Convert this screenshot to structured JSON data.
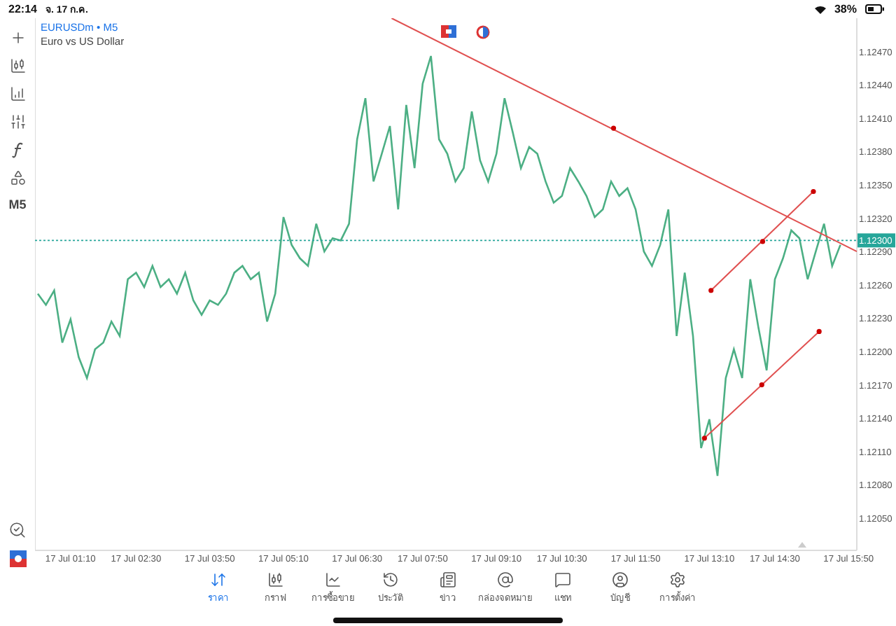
{
  "status_bar": {
    "time": "22:14",
    "date": "จ. 17 ก.ค.",
    "battery": "38%"
  },
  "header": {
    "symbol": "EURUSDm",
    "separator": "•",
    "timeframe": "M5",
    "description": "Euro vs US Dollar"
  },
  "toolbar": {
    "timeframe": "M5"
  },
  "chart": {
    "chart_data": {
      "type": "line",
      "ylim": [
        1.12021,
        1.125
      ],
      "categories": [
        null,
        null,
        null,
        null,
        "17 Jul 01:10",
        null,
        null,
        null,
        null,
        null,
        null,
        null,
        "17 Jul 02:30",
        null,
        null,
        null,
        null,
        null,
        null,
        null,
        null,
        "17 Jul 03:50",
        null,
        null,
        null,
        null,
        null,
        null,
        null,
        null,
        "17 Jul 05:10",
        null,
        null,
        null,
        null,
        null,
        null,
        null,
        null,
        "17 Jul 06:30",
        null,
        null,
        null,
        null,
        null,
        null,
        null,
        "17 Jul 07:50",
        null,
        null,
        null,
        null,
        null,
        null,
        null,
        null,
        "17 Jul 09:10",
        null,
        null,
        null,
        null,
        null,
        null,
        null,
        "17 Jul 10:30",
        null,
        null,
        null,
        null,
        null,
        null,
        null,
        null,
        "17 Jul 11:50",
        null,
        null,
        null,
        null,
        null,
        null,
        null,
        null,
        "17 Jul 13:10",
        null,
        null,
        null,
        null,
        null,
        null,
        null,
        "17 Jul 14:30",
        null,
        null,
        null,
        null,
        null,
        null,
        null,
        null,
        "17 Jul 15:50"
      ],
      "series": [
        {
          "color": "#4caf84",
          "values": [
            1.12252,
            1.12242,
            1.12255,
            1.12208,
            1.12229,
            1.12195,
            1.12176,
            1.12202,
            1.12208,
            1.12227,
            1.12214,
            1.12265,
            1.12271,
            1.12258,
            1.12277,
            1.12258,
            1.12265,
            1.12252,
            1.12271,
            1.12246,
            1.12233,
            1.12246,
            1.12242,
            1.12252,
            1.12271,
            1.12277,
            1.12265,
            1.12271,
            1.12227,
            1.12252,
            1.12321,
            1.12296,
            1.12284,
            1.12277,
            1.12315,
            1.1229,
            1.12302,
            1.123,
            1.12315,
            1.12391,
            1.12428,
            1.12353,
            1.12378,
            1.12403,
            1.12328,
            1.12422,
            1.12365,
            1.12441,
            1.12466,
            1.12391,
            1.12378,
            1.12353,
            1.12365,
            1.12416,
            1.12372,
            1.12353,
            1.12378,
            1.12428,
            1.12397,
            1.12365,
            1.12384,
            1.12378,
            1.12353,
            1.12334,
            1.1234,
            1.12365,
            1.12353,
            1.1234,
            1.12321,
            1.12328,
            1.12353,
            1.1234,
            1.12347,
            1.12328,
            1.1229,
            1.12277,
            1.12296,
            1.12328,
            1.12214,
            1.12271,
            1.12214,
            1.12113,
            1.12139,
            1.12088,
            1.12176,
            1.12202,
            1.12176,
            1.12265,
            1.12221,
            1.12183,
            1.12265,
            1.12284,
            1.12309,
            1.12302,
            1.12265,
            1.1229,
            1.12315,
            1.12277,
            1.12296,
            null
          ]
        }
      ],
      "yticks": [
        {
          "value": 1.1247,
          "label": "1.12470"
        },
        {
          "value": 1.1244,
          "label": "1.12440"
        },
        {
          "value": 1.1241,
          "label": "1.12410"
        },
        {
          "value": 1.1238,
          "label": "1.12380"
        },
        {
          "value": 1.1235,
          "label": "1.12350"
        },
        {
          "value": 1.1232,
          "label": "1.12320"
        },
        {
          "value": 1.1229,
          "label": "1.12290"
        },
        {
          "value": 1.1226,
          "label": "1.12260"
        },
        {
          "value": 1.1223,
          "label": "1.12230"
        },
        {
          "value": 1.122,
          "label": "1.12200"
        },
        {
          "value": 1.1217,
          "label": "1.12170"
        },
        {
          "value": 1.1214,
          "label": "1.12140"
        },
        {
          "value": 1.1211,
          "label": "1.12110"
        },
        {
          "value": 1.1208,
          "label": "1.12080"
        },
        {
          "value": 1.1205,
          "label": "1.12050"
        }
      ],
      "ref_lines": [
        {
          "axis": "y",
          "value": 1.123,
          "label": "1.12300"
        }
      ]
    },
    "drawings": [
      {
        "kind": "trend_line"
      },
      {
        "kind": "trend_line"
      },
      {
        "kind": "trend_line"
      }
    ]
  },
  "tabs": [
    {
      "label": "ราคา",
      "selected": true
    },
    {
      "label": "กราฟ",
      "selected": false
    },
    {
      "label": "การซื้อขาย",
      "selected": false
    },
    {
      "label": "ประวัติ",
      "selected": false
    },
    {
      "label": "ข่าว",
      "selected": false
    },
    {
      "label": "กล่องจดหมาย",
      "selected": false
    },
    {
      "label": "แชท",
      "selected": false
    },
    {
      "label": "บัญชี",
      "selected": false
    },
    {
      "label": "การตั้งค่า",
      "selected": false
    }
  ]
}
